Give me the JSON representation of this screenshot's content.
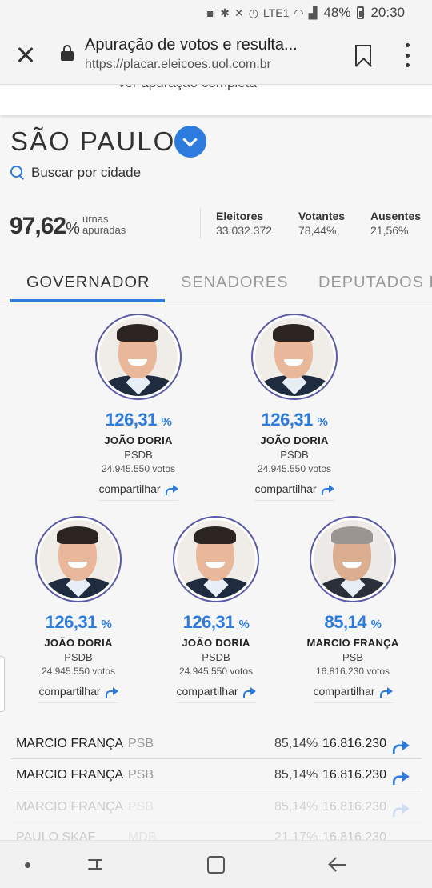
{
  "status_bar": {
    "battery": "48%",
    "time": "20:30",
    "network": "LTE1"
  },
  "browser": {
    "title": "Apuração de votos e resulta...",
    "url": "https://placar.eleicoes.uol.com.br"
  },
  "top_card": {
    "link_text": "ver apuração completa"
  },
  "state": {
    "name": "SÃO PAULO",
    "search_label": "Buscar por cidade"
  },
  "stats": {
    "urnas_pct": "97,62",
    "pct_symbol": "%",
    "urnas_label_1": "urnas",
    "urnas_label_2": "apuradas",
    "eleitores_label": "Eleitores",
    "eleitores_value": "33.032.372",
    "votantes_label": "Votantes",
    "votantes_value": "78,44%",
    "ausentes_label": "Ausentes",
    "ausentes_value": "21,56%"
  },
  "tabs": [
    {
      "label": "GOVERNADOR",
      "active": true
    },
    {
      "label": "SENADORES",
      "active": false
    },
    {
      "label": "DEPUTADOS F",
      "active": false
    }
  ],
  "candidates": [
    {
      "pct": "126,31",
      "pct_symbol": "%",
      "name": "JOÃO DORIA",
      "party": "PSDB",
      "votes": "24.945.550  votos",
      "share_label": "compartilhar"
    },
    {
      "pct": "126,31",
      "pct_symbol": "%",
      "name": "JOÃO DORIA",
      "party": "PSDB",
      "votes": "24.945.550  votos",
      "share_label": "compartilhar"
    },
    {
      "pct": "126,31",
      "pct_symbol": "%",
      "name": "JOÃO DORIA",
      "party": "PSDB",
      "votes": "24.945.550  votos",
      "share_label": "compartilhar"
    },
    {
      "pct": "126,31",
      "pct_symbol": "%",
      "name": "JOÃO DORIA",
      "party": "PSDB",
      "votes": "24.945.550  votos",
      "share_label": "compartilhar"
    },
    {
      "pct": "85,14",
      "pct_symbol": "%",
      "name": "MARCIO FRANÇA",
      "party": "PSB",
      "votes": "16.816.230  votos",
      "share_label": "compartilhar"
    }
  ],
  "results_list": [
    {
      "name": "MARCIO FRANÇA",
      "party": "PSB",
      "pct": "85,14%",
      "votes": "16.816.230"
    },
    {
      "name": "MARCIO FRANÇA",
      "party": "PSB",
      "pct": "85,14%",
      "votes": "16.816.230"
    },
    {
      "name": "MARCIO FRANÇA",
      "party": "PSB",
      "pct": "85,14%",
      "votes": "16.816.230"
    },
    {
      "name": "PAULO SKAF",
      "party": "MDB",
      "pct": "21,17%",
      "votes": "16.816.230"
    }
  ],
  "colors": {
    "accent": "#2e7bde",
    "avatar_ring": "#5a5aa8"
  },
  "icons": [
    "close-icon",
    "lock-icon",
    "bookmark-icon",
    "menu-icon",
    "chevron-down-icon",
    "search-icon",
    "share-icon"
  ]
}
